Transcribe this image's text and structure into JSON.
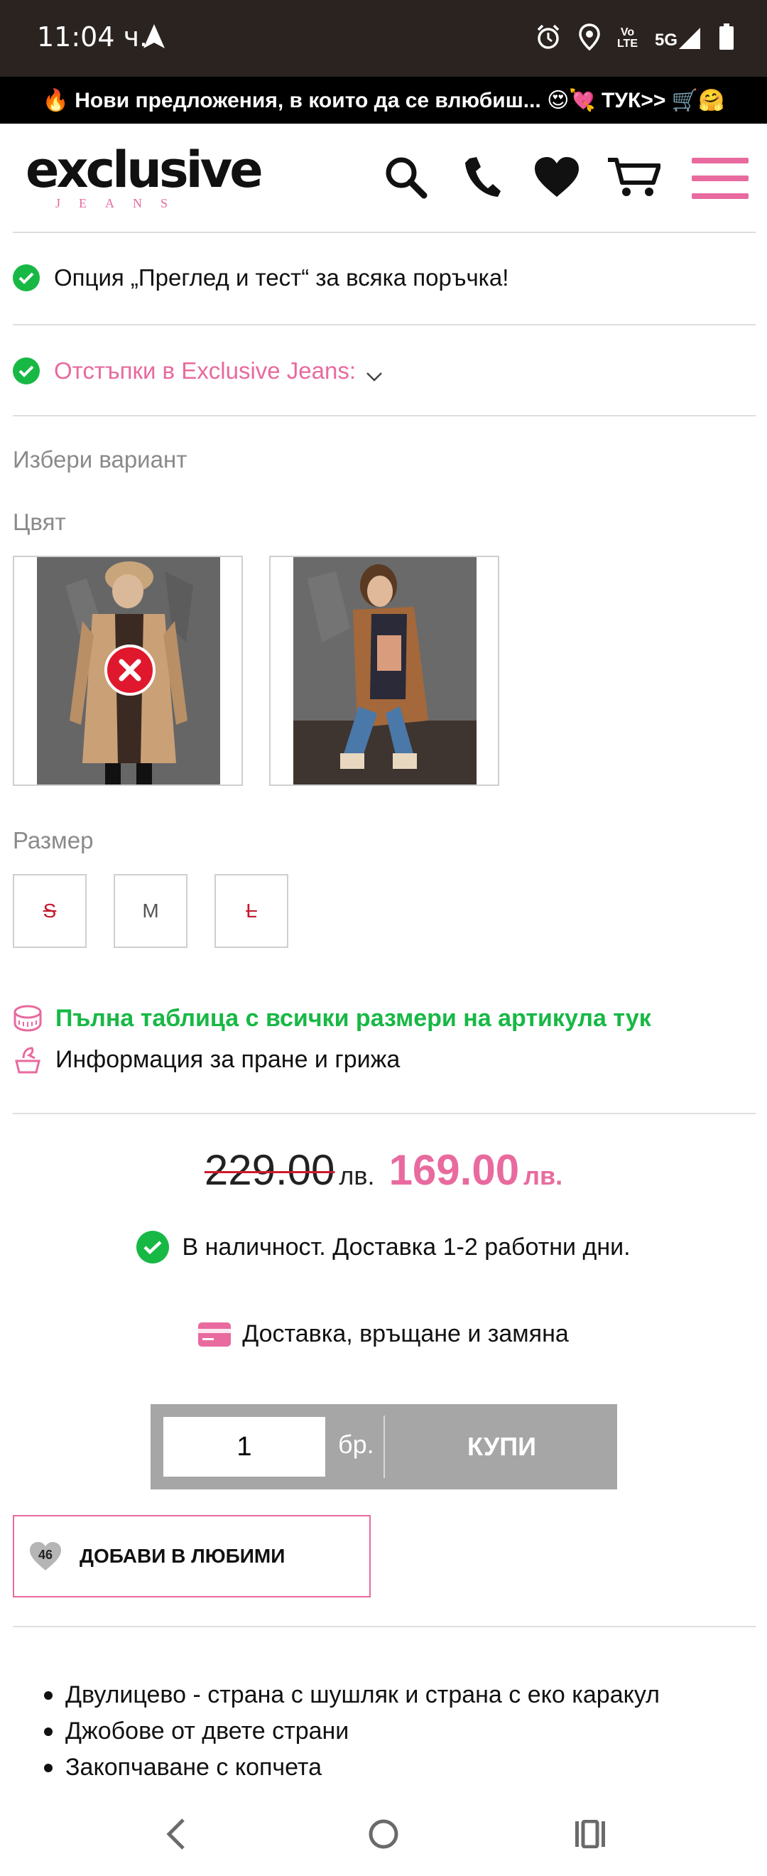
{
  "status_bar": {
    "time": "11:04 ч.",
    "volte_top": "Vo",
    "volte_bottom": "LTE",
    "network": "5G"
  },
  "promo": {
    "text": "🔥 Нови предложения, в които да се влюбиш... 😍💘 ТУК>> 🛒🤗"
  },
  "header": {
    "logo_text": "exclusive",
    "logo_subtext": "JEANS",
    "icons": [
      "search-icon",
      "phone-icon",
      "heart-icon",
      "cart-icon",
      "menu-icon"
    ],
    "accent_color": "#e86a9e"
  },
  "options": {
    "inspect_test": "Опция „Преглед и тест“ за всяка поръчка!",
    "discounts": "Отстъпки в Exclusive Jeans:"
  },
  "variant": {
    "choose_label": "Избери вариант",
    "color_label": "Цвят",
    "swatches": [
      {
        "name": "beige",
        "available": false
      },
      {
        "name": "camel",
        "available": true
      }
    ],
    "size_label": "Размер",
    "sizes": [
      {
        "label": "S",
        "available": false
      },
      {
        "label": "M",
        "available": true
      },
      {
        "label": "L",
        "available": false
      }
    ]
  },
  "links": {
    "size_table": "Пълна таблица с всички размери на артикула тук",
    "care_info": "Информация за пране и грижа"
  },
  "price": {
    "old": "229.00",
    "old_currency": "лв.",
    "new": "169.00",
    "new_currency": "лв."
  },
  "stock": {
    "text": "В наличност. Доставка 1-2 работни дни."
  },
  "delivery": {
    "text": "Доставка, връщане и замяна"
  },
  "buy": {
    "quantity": "1",
    "unit": "бр.",
    "button_label": "КУПИ"
  },
  "favorites": {
    "count": "46",
    "label": "ДОБАВИ В ЛЮБИМИ"
  },
  "features": [
    "Двулицево - страна с шушляк и страна с еко каракул",
    "Джобове от двете страни",
    "Закопчаване с копчета"
  ]
}
